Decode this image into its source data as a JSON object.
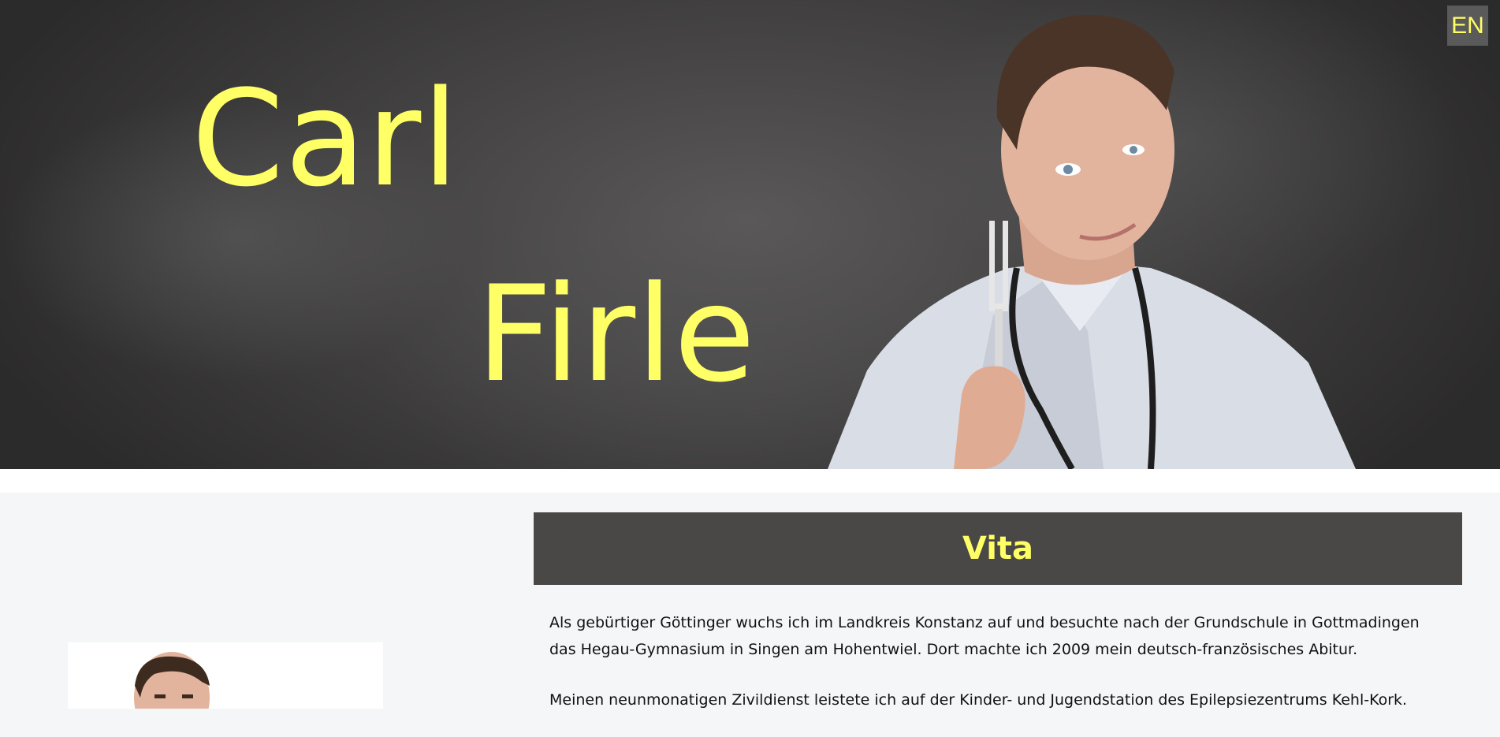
{
  "hero": {
    "first_name": "Carl",
    "last_name": "Firle",
    "language_toggle": "EN",
    "portrait_icon": "doctor-with-tuning-fork-portrait"
  },
  "colors": {
    "accent": "#ffff66",
    "header_bg": "#4a4747",
    "page_bg": "#f5f6f8"
  },
  "vita": {
    "title": "Vita",
    "paragraphs": [
      "Als gebürtiger Göttinger wuchs ich im Landkreis Konstanz auf und besuchte nach der Grundschule in Gottmadingen das Hegau-Gymnasium in Singen am Hohentwiel. Dort machte ich 2009 mein deutsch-französisches Abitur.",
      "Meinen neunmonatigen Zivildienst leistete ich auf der Kinder- und Jugendstation des Epilepsiezentrums Kehl-Kork."
    ]
  },
  "sidebar": {
    "photo_icon": "portrait-photo"
  }
}
